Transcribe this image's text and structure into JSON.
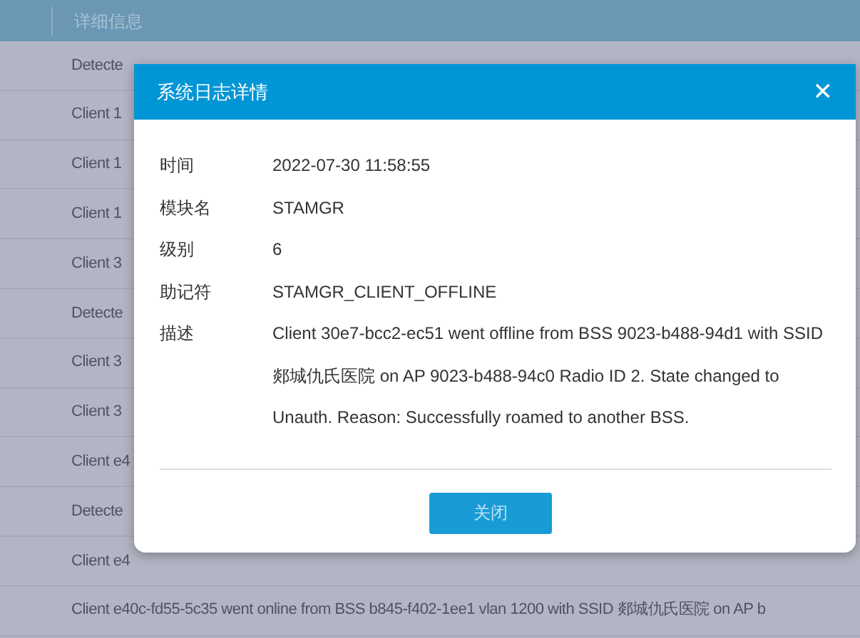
{
  "table": {
    "columns": [
      "详细信息"
    ],
    "rows": [
      "Detecte",
      "Client 1",
      "Client 1",
      "Client 1",
      "Client 3",
      "Detecte",
      "Client 3",
      "Client 3",
      "Client e4",
      "Detecte",
      "Client e4",
      "Client e40c-fd55-5c35 went online from BSS b845-f402-1ee1 vlan 1200 with SSID 郯城仇氏医院 on AP b"
    ]
  },
  "dialog": {
    "title": "系统日志详情",
    "close_icon": "✕",
    "fields": [
      {
        "label": "时间",
        "value": "2022-07-30 11:58:55"
      },
      {
        "label": "模块名",
        "value": "STAMGR"
      },
      {
        "label": "级别",
        "value": "6"
      },
      {
        "label": "助记符",
        "value": "STAMGR_CLIENT_OFFLINE"
      },
      {
        "label": "描述",
        "value": "Client 30e7-bcc2-ec51 went offline from BSS 9023-b488-94d1 with SSID 郯城仇氏医院 on AP 9023-b488-94c0 Radio ID 2. State changed to Unauth. Reason: Successfully roamed to another BSS."
      }
    ],
    "buttons": [
      "关闭"
    ]
  }
}
